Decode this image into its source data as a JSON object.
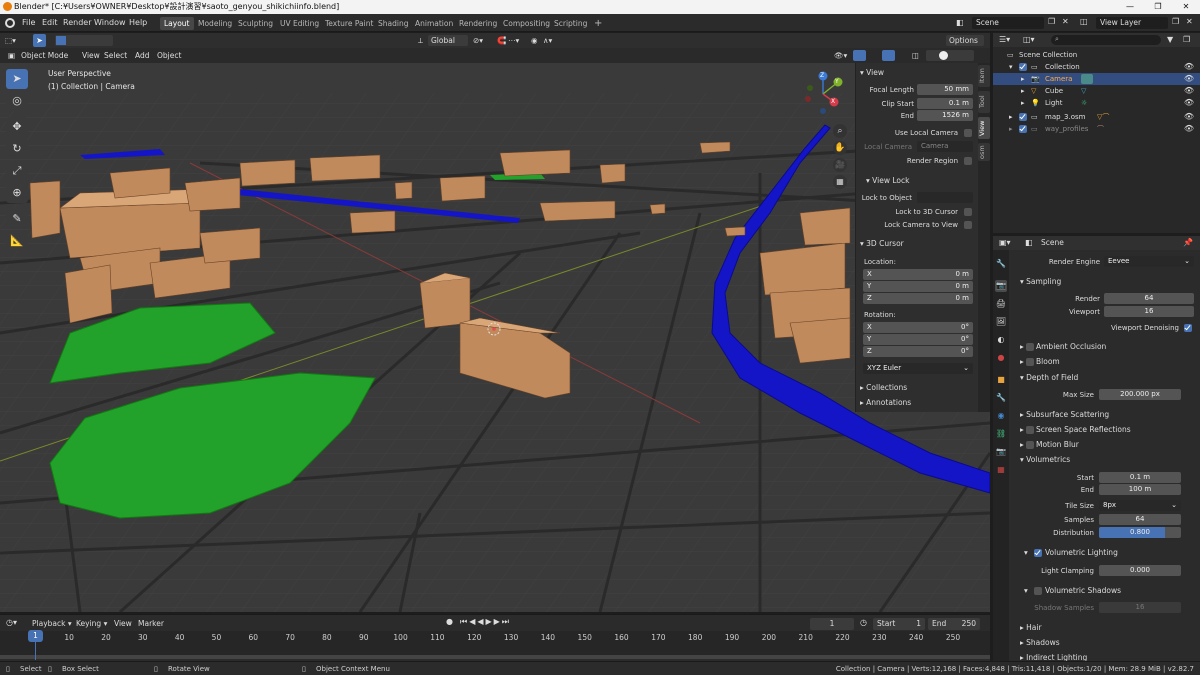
{
  "titlebar": {
    "title": "Blender* [C:¥Users¥OWNER¥Desktop¥設計演習¥saoto_genyou_shikichiinfo.blend]"
  },
  "menu": [
    "File",
    "Edit",
    "Render",
    "Window",
    "Help"
  ],
  "workspaces": [
    "Layout",
    "Modeling",
    "Sculpting",
    "UV Editing",
    "Texture Paint",
    "Shading",
    "Animation",
    "Rendering",
    "Compositing",
    "Scripting"
  ],
  "active_workspace": "Layout",
  "scene": {
    "name": "Scene",
    "view_layer": "View Layer"
  },
  "viewport_header": {
    "transform": "Global",
    "options": "Options",
    "mode": "Object Mode",
    "menus": [
      "View",
      "Select",
      "Add",
      "Object"
    ]
  },
  "viewport": {
    "perspective": "User Perspective",
    "collection_line": "(1) Collection | Camera",
    "gizmo": {
      "z": "Z",
      "y": "Y",
      "x": "X"
    }
  },
  "npanel": {
    "view_title": "View",
    "focal_length_label": "Focal Length",
    "focal_length": "50 mm",
    "clip_start_label": "Clip Start",
    "clip_start": "0.1 m",
    "end_label": "End",
    "clip_end": "1526 m",
    "use_local_camera": "Use Local Camera",
    "local_camera_label": "Local Camera",
    "local_camera_value": "Camera",
    "render_region": "Render Region",
    "view_lock_title": "View Lock",
    "lock_to_object": "Lock to Object",
    "lock_to_cursor": "Lock to 3D Cursor",
    "lock_camera": "Lock Camera to View",
    "cursor_title": "3D Cursor",
    "location_label": "Location:",
    "rotation_label": "Rotation:",
    "loc": [
      {
        "axis": "X",
        "value": "0 m"
      },
      {
        "axis": "Y",
        "value": "0 m"
      },
      {
        "axis": "Z",
        "value": "0 m"
      }
    ],
    "rot": [
      {
        "axis": "X",
        "value": "0°"
      },
      {
        "axis": "Y",
        "value": "0°"
      },
      {
        "axis": "Z",
        "value": "0°"
      }
    ],
    "rotation_mode": "XYZ Euler",
    "collections": "Collections",
    "annotations": "Annotations",
    "tabs": [
      "Item",
      "Tool",
      "View",
      "osm"
    ]
  },
  "outliner": {
    "rows": [
      {
        "label": "Scene Collection",
        "indent": 0
      },
      {
        "label": "Collection",
        "indent": 1
      },
      {
        "label": "Camera",
        "indent": 2
      },
      {
        "label": "Cube",
        "indent": 2
      },
      {
        "label": "Light",
        "indent": 2
      },
      {
        "label": "map_3.osm",
        "indent": 1
      },
      {
        "label": "way_profiles",
        "indent": 1
      }
    ]
  },
  "properties": {
    "scene_label": "Scene",
    "render_engine_label": "Render Engine",
    "render_engine": "Eevee",
    "sampling": "Sampling",
    "render_label": "Render",
    "render_samples": "64",
    "viewport_label": "Viewport",
    "viewport_samples": "16",
    "viewport_denoising": "Viewport Denoising",
    "ambient_occlusion": "Ambient Occlusion",
    "bloom": "Bloom",
    "depth_of_field": "Depth of Field",
    "max_size_label": "Max Size",
    "max_size": "200.000 px",
    "subsurface": "Subsurface Scattering",
    "ssr": "Screen Space Reflections",
    "motion_blur": "Motion Blur",
    "volumetrics": "Volumetrics",
    "vol_start_label": "Start",
    "vol_start": "0.1 m",
    "vol_end_label": "End",
    "vol_end": "100 m",
    "tile_size_label": "Tile Size",
    "tile_size": "8px",
    "samples_label": "Samples",
    "samples": "64",
    "distribution_label": "Distribution",
    "distribution": "0.800",
    "distribution_fraction": 0.8,
    "vol_lighting": "Volumetric Lighting",
    "light_clamping_label": "Light Clamping",
    "light_clamping": "0.000",
    "vol_shadows": "Volumetric Shadows",
    "shadow_samples_label": "Shadow Samples",
    "shadow_samples": "16",
    "hair": "Hair",
    "shadows": "Shadows",
    "indirect": "Indirect Lighting"
  },
  "timeline": {
    "menus": [
      "Playback",
      "Keying",
      "View",
      "Marker"
    ],
    "current_frame": "1",
    "start_label": "Start",
    "start": "1",
    "end_label": "End",
    "end": "250",
    "ticks": [
      "1",
      "10",
      "20",
      "30",
      "40",
      "50",
      "60",
      "70",
      "80",
      "90",
      "100",
      "110",
      "120",
      "130",
      "140",
      "150",
      "160",
      "170",
      "180",
      "190",
      "200",
      "210",
      "220",
      "230",
      "240",
      "250"
    ]
  },
  "statusbar": {
    "select": "Select",
    "box_select": "Box Select",
    "rotate_view": "Rotate View",
    "context_menu": "Object Context Menu",
    "stats": "Collection | Camera | Verts:12,168 | Faces:4,848 | Tris:11,418 | Objects:1/20 | Mem: 28.9 MiB | v2.82.7"
  },
  "colors": {
    "accent": "#4772b3",
    "building": "#c08a5c",
    "park": "#22a22a",
    "water": "#1515c8"
  }
}
